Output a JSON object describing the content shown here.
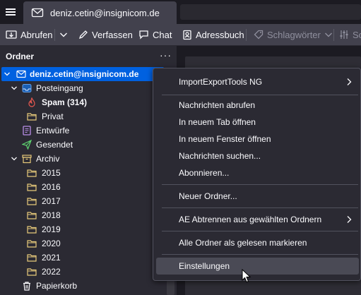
{
  "tab": {
    "title": "deniz.cetin@insignicom.de"
  },
  "toolbar": {
    "get_messages": "Abrufen",
    "write": "Verfassen",
    "chat": "Chat",
    "address_book": "Adressbuch",
    "tags": "Schlagwörter",
    "quick_filter": "Sch"
  },
  "folder_pane": {
    "title": "Ordner",
    "more": "···",
    "account": "deniz.cetin@insignicom.de",
    "folders": {
      "inbox": "Posteingang",
      "spam": "Spam (314)",
      "privat": "Privat",
      "drafts": "Entwürfe",
      "sent": "Gesendet",
      "archive": "Archiv",
      "y2015": "2015",
      "y2016": "2016",
      "y2017": "2017",
      "y2018": "2018",
      "y2019": "2019",
      "y2020": "2020",
      "y2021": "2021",
      "y2022": "2022",
      "trash": "Papierkorb"
    }
  },
  "context_menu": {
    "items": [
      {
        "label": "ImportExportTools NG",
        "submenu": true
      },
      {
        "label": "Nachrichten abrufen"
      },
      {
        "label": "In neuem Tab öffnen"
      },
      {
        "label": "In neuem Fenster öffnen"
      },
      {
        "label": "Nachrichten suchen..."
      },
      {
        "label": "Abonnieren..."
      },
      {
        "label": "Neuer Ordner..."
      },
      {
        "label": "AE Abtrennen aus gewählten Ordnern",
        "submenu": true
      },
      {
        "label": "Alle Ordner als gelesen markieren"
      },
      {
        "label": "Einstellungen",
        "hovered": true
      }
    ]
  },
  "colors": {
    "accent": "#0061e0",
    "toolbar": "#42414d",
    "pane": "#2b2a33",
    "spam_icon": "#e8584f",
    "drafts_icon": "#b98ee8",
    "sent_icon": "#5ed470",
    "folder_icon": "#e7c97a"
  }
}
